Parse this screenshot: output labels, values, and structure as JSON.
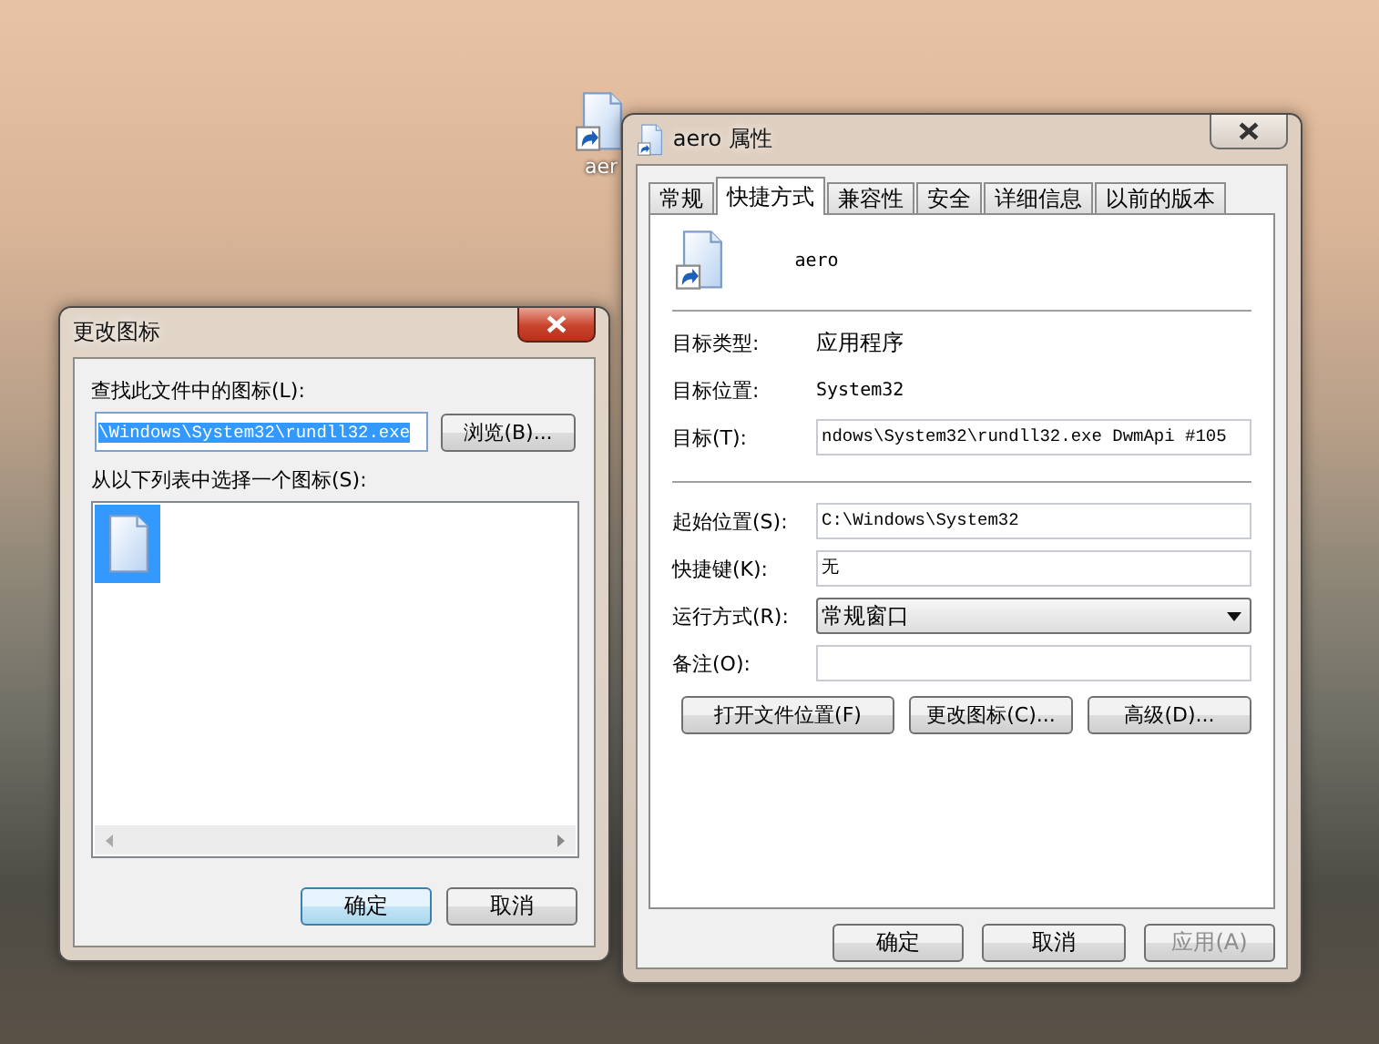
{
  "desktop": {
    "icon_label": "aer"
  },
  "properties_window": {
    "title": "aero 属性",
    "active": false,
    "tabs": [
      {
        "label": "常规",
        "selected": false
      },
      {
        "label": "快捷方式",
        "selected": true
      },
      {
        "label": "兼容性",
        "selected": false
      },
      {
        "label": "安全",
        "selected": false
      },
      {
        "label": "详细信息",
        "selected": false
      },
      {
        "label": "以前的版本",
        "selected": false
      }
    ],
    "file_name": "aero",
    "details": [
      {
        "label": "目标类型:",
        "value": "应用程序"
      },
      {
        "label": "目标位置:",
        "value": "System32"
      },
      {
        "label": "目标(T):",
        "value": "ndows\\System32\\rundll32.exe DwmApi #105",
        "kind": "input"
      }
    ],
    "fields": [
      {
        "label": "起始位置(S):",
        "value": "C:\\Windows\\System32",
        "kind": "input"
      },
      {
        "label": "快捷键(K):",
        "value": "无",
        "kind": "input"
      },
      {
        "label": "运行方式(R):",
        "value": "常规窗口",
        "kind": "dropdown"
      },
      {
        "label": "备注(O):",
        "kind": "input"
      }
    ],
    "action_buttons": [
      "打开文件位置(F)",
      "更改图标(C)...",
      "高级(D)..."
    ],
    "buttons": [
      {
        "label": "确定",
        "disabled": false
      },
      {
        "label": "取消",
        "disabled": false
      },
      {
        "label": "应用(A)",
        "disabled": true
      }
    ]
  },
  "change_icon_dialog": {
    "title": "更改图标",
    "active": true,
    "file_label": "查找此文件中的图标(L):",
    "file_path": {
      "value": "\\Windows\\System32\\rundll32.exe",
      "text_selected": true
    },
    "browse_button": "浏览(B)...",
    "list_label": "从以下列表中选择一个图标(S):",
    "icons": [
      {
        "selected": true
      }
    ],
    "buttons": [
      {
        "label": "确定",
        "default": true
      },
      {
        "label": "取消",
        "default": false
      }
    ]
  }
}
